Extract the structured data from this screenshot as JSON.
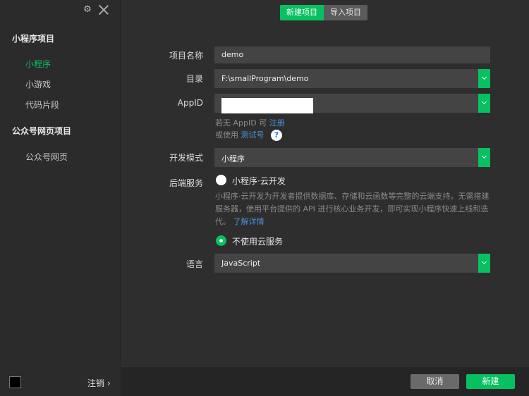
{
  "sidebar": {
    "section_miniprogram": "小程序项目",
    "items_miniprogram": [
      "小程序",
      "小游戏",
      "代码片段"
    ],
    "section_official": "公众号网页项目",
    "items_official": [
      "公众号网页"
    ],
    "logout_label": "注销 ›"
  },
  "tabs": {
    "new_project": "新建项目",
    "import_project": "导入项目"
  },
  "form": {
    "name_label": "项目名称",
    "name_value": "demo",
    "dir_label": "目录",
    "dir_value": "F:\\smallProgram\\demo",
    "appid_label": "AppID",
    "appid_hint_prefix": "若无 AppID 可",
    "appid_hint_register": "注册",
    "appid_hint2_prefix": "或使用",
    "appid_hint2_link": "测试号",
    "help_icon_text": "?",
    "mode_label": "开发模式",
    "mode_value": "小程序",
    "backend_label": "后端服务",
    "cloud_option_label": "小程序·云开发",
    "cloud_desc": "小程序·云开发为开发者提供数据库、存储和云函数等完整的云端支持。无需搭建服务器，使用平台提供的 API 进行核心业务开发，即可实现小程序快速上线和迭代。",
    "cloud_more_link": "了解详情",
    "no_cloud_option_label": "不使用云服务",
    "lang_label": "语言",
    "lang_value": "JavaScript"
  },
  "footer": {
    "cancel_label": "取消",
    "create_label": "新建"
  },
  "colors": {
    "accent": "#07c160",
    "link": "#4a90d9"
  }
}
